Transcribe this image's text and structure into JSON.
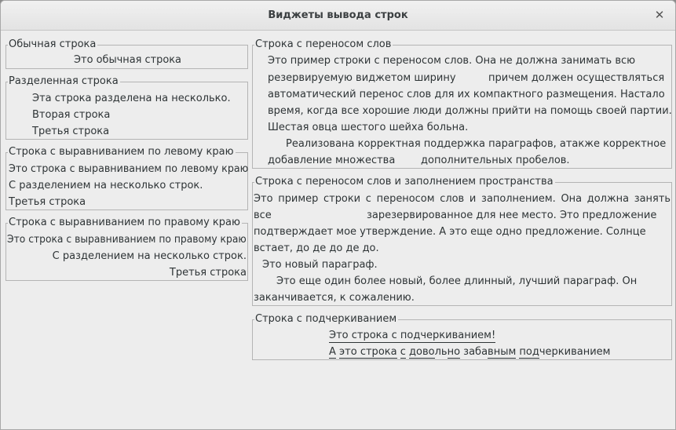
{
  "window": {
    "title": "Виджеты вывода строк"
  },
  "icons": {
    "close": "close-icon"
  },
  "plain": {
    "legend": "Обычная строка",
    "text": "Это обычная строка"
  },
  "split": {
    "legend": "Разделенная строка",
    "lines": [
      "Эта строка разделена на несколько.",
      "Вторая строка",
      "Третья строка"
    ]
  },
  "left": {
    "legend": "Строка с выравниванием по левому краю",
    "lines": [
      "Это строка с выравниванием по левому краю",
      "С разделением на несколько строк.",
      "Третья строка"
    ]
  },
  "right": {
    "legend": "Строка с выравниванием по правому краю",
    "lines": [
      "Это строка с выравниванием по правому краю",
      "С разделением на несколько строк.",
      "Третья строка"
    ]
  },
  "wrap": {
    "legend": "Строка с переносом слов",
    "lines": [
      "Это пример строки с переносом слов.  Она не должна занимать всю",
      "резервируемую виджетом ширину",
      "причем должен осуществляться",
      "автоматический перенос слов для их компактного размещения.  Настало",
      "время, когда все хорошие люди должны прийти на помощь своей партии.",
      "Шестая овца шестого шейха больна.",
      "Реализована корректная поддержка параграфов, атакже  корректное",
      "добавление множества",
      "дополнительных  пробелов."
    ]
  },
  "fill": {
    "legend": "Строка с переносом слов и заполнением пространства",
    "lines": [
      "Это пример строки с переносом слов и заполнением.   Она должна занять",
      "все",
      "зарезервированное для нее место.   Это предложение",
      "подтверждает мое утверждение.   А это еще одно предложение. Солнце",
      "встает, до де до де до.",
      "Это новый параграф.",
      "Это еще один более новый, более длинный, лучший параграф.   Он",
      "заканчивается, к сожалению."
    ]
  },
  "under": {
    "legend": "Строка с подчеркиванием",
    "line1": "Это строка с подчеркиванием!",
    "line2_parts": [
      "А",
      " ",
      "это строка",
      " ",
      "с",
      " ",
      "дово",
      "ль",
      "но",
      " ",
      "заба",
      "вным",
      " ",
      "под",
      "черкиванием"
    ]
  }
}
